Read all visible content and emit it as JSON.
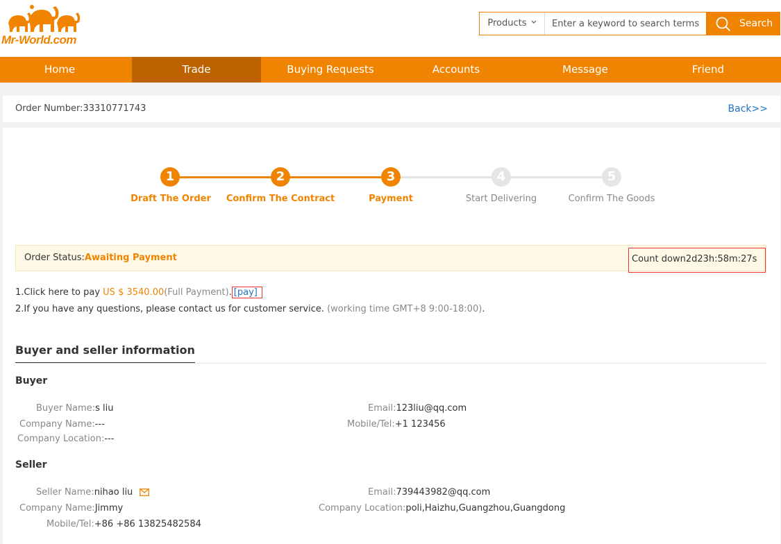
{
  "header": {
    "logo_text": "Mr-World.com",
    "search": {
      "category": "Products",
      "placeholder": "Enter a keyword to search terms",
      "button_label": "Search"
    }
  },
  "nav": {
    "items": [
      "Home",
      "Trade",
      "Buying Requests",
      "Accounts",
      "Message",
      "Friend"
    ],
    "active": "Trade"
  },
  "order": {
    "number_label": "Order Number:",
    "number": "33310771743",
    "back_label": "Back>>"
  },
  "steps": [
    {
      "num": "1",
      "label": "Draft The Order",
      "done": true
    },
    {
      "num": "2",
      "label": "Confirm The Contract",
      "done": true
    },
    {
      "num": "3",
      "label": "Payment",
      "done": true
    },
    {
      "num": "4",
      "label": "Start Delivering",
      "done": false
    },
    {
      "num": "5",
      "label": "Confirm The Goods",
      "done": false
    }
  ],
  "status": {
    "label": "Order Status:",
    "value": "Awaiting Payment",
    "countdown_label": "Count down",
    "countdown": "2d23h:58m:27s"
  },
  "instructions": {
    "line1_prefix": "1.Click here to pay ",
    "amount": "US $ 3540.00",
    "payment_type": "(Full Payment)",
    "separator": ".",
    "pay_link": "[pay]",
    "line2_text": "2.If you have any questions, please contact us for customer service. ",
    "working_time": "(working time GMT+8 9:00-18:00)",
    "line2_end": "."
  },
  "section": {
    "title": "Buyer and seller information"
  },
  "buyer": {
    "title": "Buyer",
    "name_label": "Buyer Name:",
    "name": "s liu",
    "company_label": "Company Name:",
    "company": "---",
    "location_label": "Company Location:",
    "location": "---",
    "email_label": "Email:",
    "email": "123liu@qq.com",
    "mobile_label": "Mobile/Tel:",
    "mobile": "+1 123456"
  },
  "seller": {
    "title": "Seller",
    "name_label": "Seller Name:",
    "name": "nihao liu",
    "company_label": "Company Name:",
    "company": "Jimmy",
    "mobile_label": "Mobile/Tel:",
    "mobile": "+86 +86 13825482584",
    "email_label": "Email:",
    "email": "739443982@qq.com",
    "location_label": "Company Location:",
    "location": "poli,Haizhu,Guangzhou,Guangdong"
  },
  "colors": {
    "brand_orange": "#f08300",
    "nav_active": "#bc6200",
    "link_blue": "#1a73c9",
    "highlight_red": "#ee3333"
  },
  "icons": [
    "elephant-logo-icon",
    "chevron-down-icon",
    "search-icon",
    "mail-icon"
  ]
}
